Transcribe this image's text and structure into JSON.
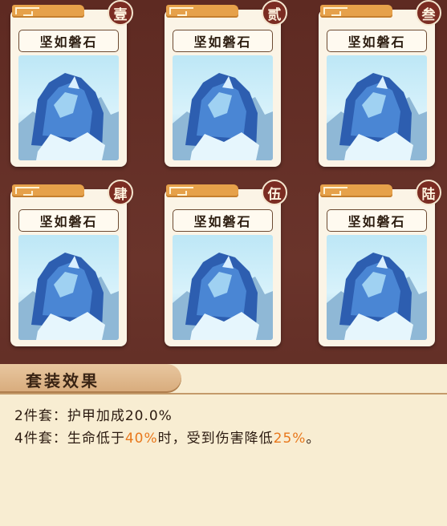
{
  "cards": [
    {
      "name": "坚如磐石",
      "badge": "壹"
    },
    {
      "name": "坚如磐石",
      "badge": "贰"
    },
    {
      "name": "坚如磐石",
      "badge": "叁"
    },
    {
      "name": "坚如磐石",
      "badge": "肆"
    },
    {
      "name": "坚如磐石",
      "badge": "伍"
    },
    {
      "name": "坚如磐石",
      "badge": "陆"
    }
  ],
  "set_effect": {
    "title": "套装效果",
    "effect_2": {
      "prefix": "2件套：",
      "text": "护甲加成20.0%"
    },
    "effect_4": {
      "prefix": "4件套：",
      "text_a": "生命低于",
      "value_a": "40%",
      "text_b": "时，受到伤害降低",
      "value_b": "25%",
      "text_c": "。"
    }
  },
  "colors": {
    "background": "#5e2a22",
    "highlight": "#e8781c",
    "badge": "#7b2c22",
    "tab": "#e6a14a"
  }
}
